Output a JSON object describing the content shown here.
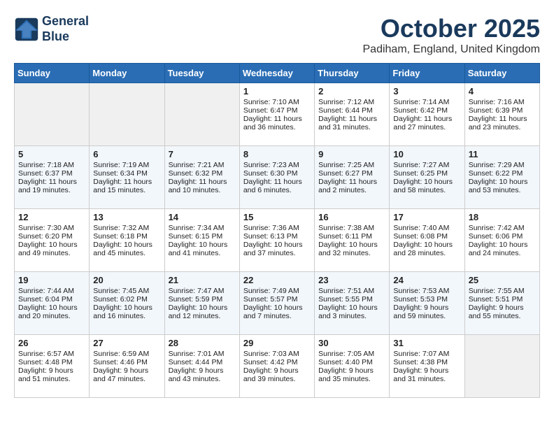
{
  "header": {
    "logo_line1": "General",
    "logo_line2": "Blue",
    "month_title": "October 2025",
    "location": "Padiham, England, United Kingdom"
  },
  "days_of_week": [
    "Sunday",
    "Monday",
    "Tuesday",
    "Wednesday",
    "Thursday",
    "Friday",
    "Saturday"
  ],
  "weeks": [
    [
      {
        "day": "",
        "sunrise": "",
        "sunset": "",
        "daylight": "",
        "empty": true
      },
      {
        "day": "",
        "sunrise": "",
        "sunset": "",
        "daylight": "",
        "empty": true
      },
      {
        "day": "",
        "sunrise": "",
        "sunset": "",
        "daylight": "",
        "empty": true
      },
      {
        "day": "1",
        "sunrise": "Sunrise: 7:10 AM",
        "sunset": "Sunset: 6:47 PM",
        "daylight": "Daylight: 11 hours and 36 minutes."
      },
      {
        "day": "2",
        "sunrise": "Sunrise: 7:12 AM",
        "sunset": "Sunset: 6:44 PM",
        "daylight": "Daylight: 11 hours and 31 minutes."
      },
      {
        "day": "3",
        "sunrise": "Sunrise: 7:14 AM",
        "sunset": "Sunset: 6:42 PM",
        "daylight": "Daylight: 11 hours and 27 minutes."
      },
      {
        "day": "4",
        "sunrise": "Sunrise: 7:16 AM",
        "sunset": "Sunset: 6:39 PM",
        "daylight": "Daylight: 11 hours and 23 minutes."
      }
    ],
    [
      {
        "day": "5",
        "sunrise": "Sunrise: 7:18 AM",
        "sunset": "Sunset: 6:37 PM",
        "daylight": "Daylight: 11 hours and 19 minutes."
      },
      {
        "day": "6",
        "sunrise": "Sunrise: 7:19 AM",
        "sunset": "Sunset: 6:34 PM",
        "daylight": "Daylight: 11 hours and 15 minutes."
      },
      {
        "day": "7",
        "sunrise": "Sunrise: 7:21 AM",
        "sunset": "Sunset: 6:32 PM",
        "daylight": "Daylight: 11 hours and 10 minutes."
      },
      {
        "day": "8",
        "sunrise": "Sunrise: 7:23 AM",
        "sunset": "Sunset: 6:30 PM",
        "daylight": "Daylight: 11 hours and 6 minutes."
      },
      {
        "day": "9",
        "sunrise": "Sunrise: 7:25 AM",
        "sunset": "Sunset: 6:27 PM",
        "daylight": "Daylight: 11 hours and 2 minutes."
      },
      {
        "day": "10",
        "sunrise": "Sunrise: 7:27 AM",
        "sunset": "Sunset: 6:25 PM",
        "daylight": "Daylight: 10 hours and 58 minutes."
      },
      {
        "day": "11",
        "sunrise": "Sunrise: 7:29 AM",
        "sunset": "Sunset: 6:22 PM",
        "daylight": "Daylight: 10 hours and 53 minutes."
      }
    ],
    [
      {
        "day": "12",
        "sunrise": "Sunrise: 7:30 AM",
        "sunset": "Sunset: 6:20 PM",
        "daylight": "Daylight: 10 hours and 49 minutes."
      },
      {
        "day": "13",
        "sunrise": "Sunrise: 7:32 AM",
        "sunset": "Sunset: 6:18 PM",
        "daylight": "Daylight: 10 hours and 45 minutes."
      },
      {
        "day": "14",
        "sunrise": "Sunrise: 7:34 AM",
        "sunset": "Sunset: 6:15 PM",
        "daylight": "Daylight: 10 hours and 41 minutes."
      },
      {
        "day": "15",
        "sunrise": "Sunrise: 7:36 AM",
        "sunset": "Sunset: 6:13 PM",
        "daylight": "Daylight: 10 hours and 37 minutes."
      },
      {
        "day": "16",
        "sunrise": "Sunrise: 7:38 AM",
        "sunset": "Sunset: 6:11 PM",
        "daylight": "Daylight: 10 hours and 32 minutes."
      },
      {
        "day": "17",
        "sunrise": "Sunrise: 7:40 AM",
        "sunset": "Sunset: 6:08 PM",
        "daylight": "Daylight: 10 hours and 28 minutes."
      },
      {
        "day": "18",
        "sunrise": "Sunrise: 7:42 AM",
        "sunset": "Sunset: 6:06 PM",
        "daylight": "Daylight: 10 hours and 24 minutes."
      }
    ],
    [
      {
        "day": "19",
        "sunrise": "Sunrise: 7:44 AM",
        "sunset": "Sunset: 6:04 PM",
        "daylight": "Daylight: 10 hours and 20 minutes."
      },
      {
        "day": "20",
        "sunrise": "Sunrise: 7:45 AM",
        "sunset": "Sunset: 6:02 PM",
        "daylight": "Daylight: 10 hours and 16 minutes."
      },
      {
        "day": "21",
        "sunrise": "Sunrise: 7:47 AM",
        "sunset": "Sunset: 5:59 PM",
        "daylight": "Daylight: 10 hours and 12 minutes."
      },
      {
        "day": "22",
        "sunrise": "Sunrise: 7:49 AM",
        "sunset": "Sunset: 5:57 PM",
        "daylight": "Daylight: 10 hours and 7 minutes."
      },
      {
        "day": "23",
        "sunrise": "Sunrise: 7:51 AM",
        "sunset": "Sunset: 5:55 PM",
        "daylight": "Daylight: 10 hours and 3 minutes."
      },
      {
        "day": "24",
        "sunrise": "Sunrise: 7:53 AM",
        "sunset": "Sunset: 5:53 PM",
        "daylight": "Daylight: 9 hours and 59 minutes."
      },
      {
        "day": "25",
        "sunrise": "Sunrise: 7:55 AM",
        "sunset": "Sunset: 5:51 PM",
        "daylight": "Daylight: 9 hours and 55 minutes."
      }
    ],
    [
      {
        "day": "26",
        "sunrise": "Sunrise: 6:57 AM",
        "sunset": "Sunset: 4:48 PM",
        "daylight": "Daylight: 9 hours and 51 minutes."
      },
      {
        "day": "27",
        "sunrise": "Sunrise: 6:59 AM",
        "sunset": "Sunset: 4:46 PM",
        "daylight": "Daylight: 9 hours and 47 minutes."
      },
      {
        "day": "28",
        "sunrise": "Sunrise: 7:01 AM",
        "sunset": "Sunset: 4:44 PM",
        "daylight": "Daylight: 9 hours and 43 minutes."
      },
      {
        "day": "29",
        "sunrise": "Sunrise: 7:03 AM",
        "sunset": "Sunset: 4:42 PM",
        "daylight": "Daylight: 9 hours and 39 minutes."
      },
      {
        "day": "30",
        "sunrise": "Sunrise: 7:05 AM",
        "sunset": "Sunset: 4:40 PM",
        "daylight": "Daylight: 9 hours and 35 minutes."
      },
      {
        "day": "31",
        "sunrise": "Sunrise: 7:07 AM",
        "sunset": "Sunset: 4:38 PM",
        "daylight": "Daylight: 9 hours and 31 minutes."
      },
      {
        "day": "",
        "sunrise": "",
        "sunset": "",
        "daylight": "",
        "empty": true
      }
    ]
  ]
}
